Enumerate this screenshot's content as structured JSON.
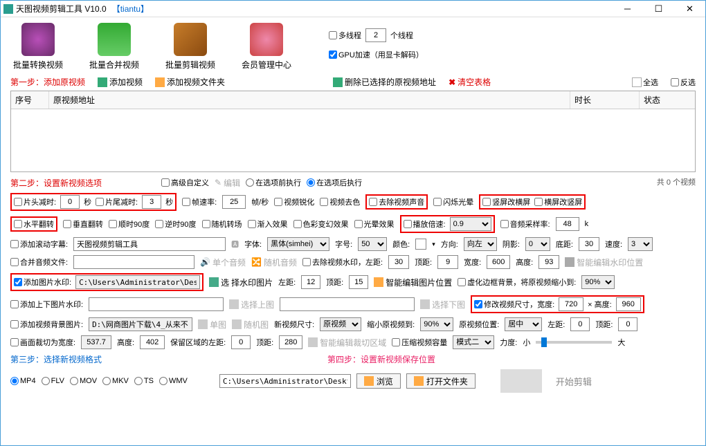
{
  "title": {
    "app": "天图视频剪辑工具 V10.0",
    "brand": "【tiantu】"
  },
  "toolbar": {
    "btn1": "批量转换视频",
    "btn2": "批量合并视频",
    "btn3": "批量剪辑视频",
    "btn4": "会员管理中心",
    "multithread": "多线程",
    "threads": "2",
    "threads_unit": "个线程",
    "gpu": "GPU加速（用显卡解码）"
  },
  "step1": {
    "label": "第一步：添加原视频",
    "add_video": "添加视频",
    "add_folder": "添加视频文件夹",
    "del_selected": "删除已选择的原视频地址",
    "clear": "清空表格",
    "select_all": "全选",
    "invert": "反选"
  },
  "grid": {
    "col1": "序号",
    "col2": "原视频地址",
    "col3": "时长",
    "col4": "状态"
  },
  "summary": "共 0 个视频",
  "step2": {
    "label": "第二步：设置新视频选项",
    "advanced": "高级自定义",
    "edit": "编辑",
    "before": "在选项前执行",
    "after": "在选项后执行",
    "head_cut": "片头减时:",
    "head_val": "0",
    "head_unit": "秒",
    "tail_cut": "片尾减时:",
    "tail_val": "3",
    "tail_unit": "秒",
    "fps": "帧速率:",
    "fps_val": "25",
    "fps_unit": "帧/秒",
    "sharpen": "视频锐化",
    "desat": "视频去色",
    "remove_audio": "去除视频声音",
    "flash": "闪烁光晕",
    "v2h": "竖屏改横屏",
    "h2v": "横屏改竖屏",
    "hflip": "水平翻转",
    "vflip": "垂直翻转",
    "cw90": "顺时90度",
    "ccw90": "逆时90度",
    "random": "随机转场",
    "fadein": "渐入效果",
    "colorshift": "色彩变幻效果",
    "glow": "光晕效果",
    "speed": "播放倍速:",
    "speed_val": "0.9",
    "samplerate": "音频采样率:",
    "samplerate_val": "48",
    "samplerate_unit": "k",
    "subtitle": "添加滚动字幕:",
    "subtitle_val": "天图视频剪辑工具",
    "font": "字体:",
    "font_val": "黑体(simhei)",
    "fontsize": "字号:",
    "fontsize_val": "50",
    "color": "颜色:",
    "dir": "方向:",
    "dir_val": "向左",
    "shadow": "阴影:",
    "shadow_val": "0",
    "bottom": "底距:",
    "bottom_val": "30",
    "speed2": "速度:",
    "speed2_val": "3",
    "merge_audio": "合并音频文件:",
    "single_audio": "单个音频",
    "random_audio": "随机音频",
    "remove_wm": "去除视频水印，左距:",
    "wm_left": "30",
    "wm_top_l": "顶距:",
    "wm_top": "9",
    "wm_w_l": "宽度:",
    "wm_w": "600",
    "wm_h_l": "高度:",
    "wm_h": "93",
    "smart_wm": "智能编辑水印位置",
    "add_wm": "添加图片水印:",
    "wm_path": "C:\\Users\\Administrator\\Desktop\\src=h",
    "sel_wm": "择水印图片",
    "wm2_left_l": "左距:",
    "wm2_left": "12",
    "wm2_top_l": "顶距:",
    "wm2_top": "15",
    "smart_img": "智能编辑图片位置",
    "blur_border": "虚化边框背景，将原视频缩小到:",
    "blur_val": "90%",
    "add_tb": "添加上下图片水印:",
    "sel_top": "选择上图",
    "sel_bot": "选择下图",
    "resize": "修改视频尺寸，宽度:",
    "res_w": "720",
    "res_x": "× 高度:",
    "res_h": "960",
    "add_bg": "添加视频背景图片:",
    "bg_path": "D:\\网商图片下载\\4_从来不",
    "single_img": "单图",
    "random_img": "随机图",
    "new_size": "新视频尺寸:",
    "new_size_val": "原视频",
    "shrink": "缩小原视频到:",
    "shrink_val": "90%",
    "orig_pos": "原视频位置:",
    "orig_pos_val": "居中",
    "left_l": "左距:",
    "left_v": "0",
    "top_l": "顶距:",
    "top_v": "0",
    "crop": "画面裁切为宽度:",
    "crop_w": "537.7",
    "crop_h_l": "高度:",
    "crop_h": "402",
    "keep_l": "保留区域的左距:",
    "keep_l_v": "0",
    "keep_t_l": "顶距:",
    "keep_t_v": "280",
    "smart_crop": "智能编辑裁切区域",
    "compress": "压缩视频容量",
    "compress_mode": "模式二",
    "strength": "力度:",
    "small": "小",
    "big": "大"
  },
  "step3": {
    "label": "第三步：选择新视频格式",
    "mp4": "MP4",
    "flv": "FLV",
    "mov": "MOV",
    "mkv": "MKV",
    "ts": "TS",
    "wmv": "WMV"
  },
  "step4": {
    "label": "第四步：设置新视频保存位置",
    "path": "C:\\Users\\Administrator\\Desktop",
    "browse": "浏览",
    "open": "打开文件夹",
    "start": "开始剪辑"
  }
}
